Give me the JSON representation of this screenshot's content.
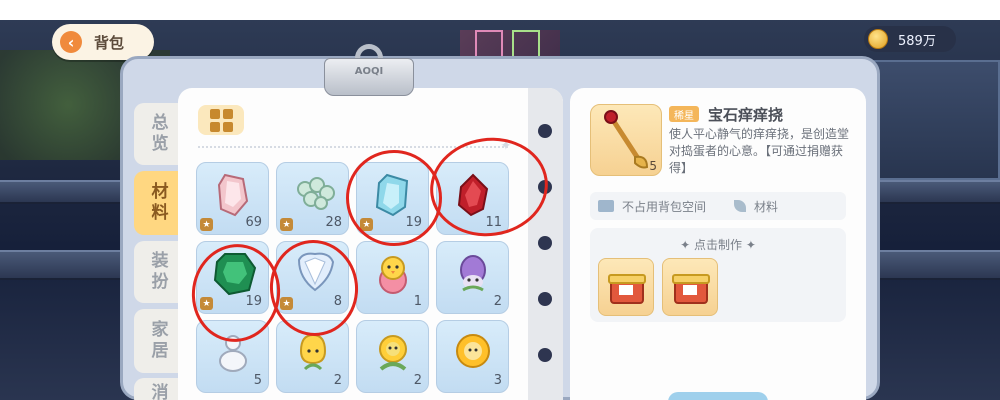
{
  "header": {
    "back_label": "背包",
    "currency_value": "589万"
  },
  "tabs": [
    {
      "label": "总览",
      "active": false
    },
    {
      "label": "材料",
      "active": true
    },
    {
      "label": "装扮",
      "active": false
    },
    {
      "label": "家居",
      "active": false
    },
    {
      "label": "消",
      "active": false
    }
  ],
  "clip": {
    "label": "AOQI"
  },
  "items": [
    {
      "name": "pink-crystal",
      "qty": "69",
      "star": true
    },
    {
      "name": "green-bubbles",
      "qty": "28",
      "star": true
    },
    {
      "name": "aquamarine",
      "qty": "19",
      "star": true
    },
    {
      "name": "ruby",
      "qty": "11",
      "star": false
    },
    {
      "name": "emerald",
      "qty": "19",
      "star": true
    },
    {
      "name": "diamond",
      "qty": "8",
      "star": true
    },
    {
      "name": "chick-flower",
      "qty": "1",
      "star": false
    },
    {
      "name": "lavender-sprite",
      "qty": "2",
      "star": false
    },
    {
      "name": "snow-sprite",
      "qty": "5",
      "star": false
    },
    {
      "name": "yellow-tulip",
      "qty": "2",
      "star": false
    },
    {
      "name": "sunflower-bud",
      "qty": "2",
      "star": false
    },
    {
      "name": "sunflower",
      "qty": "3",
      "star": false
    }
  ],
  "detail": {
    "rarity": "稀星",
    "name": "宝石痒痒挠",
    "qty": "5",
    "description": "使人平心静气的痒痒挠，是创造堂对捣蛋者的心意。【可通过捐赠获得】",
    "tag_storage": "不占用背包空间",
    "tag_type": "材料",
    "craft_title": "点击制作"
  },
  "colors": {
    "accent_orange": "#f08a3c",
    "tab_active": "#ffd781",
    "annotation_red": "#e0261e"
  }
}
